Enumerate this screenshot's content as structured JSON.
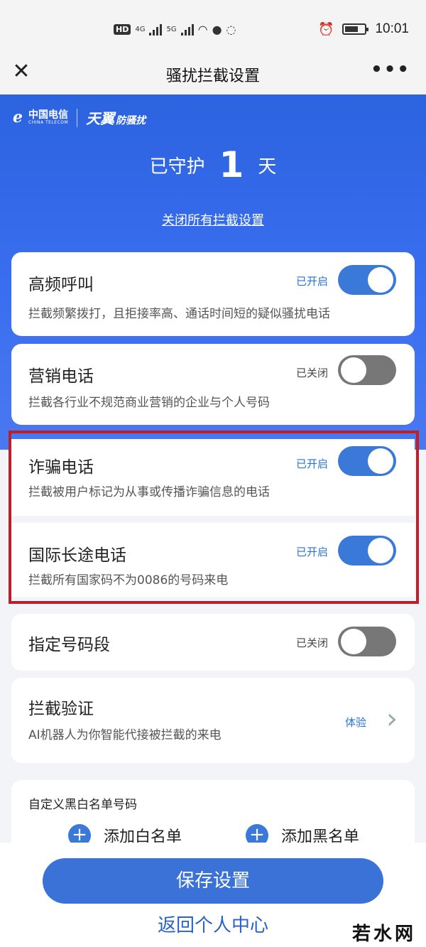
{
  "status": {
    "hd": "HD",
    "net1": "4G",
    "net2": "5G",
    "time": "10:01"
  },
  "nav": {
    "title": "骚扰拦截设置"
  },
  "hero": {
    "logo_cn": "中国电信",
    "logo_en": "CHINA TELECOM",
    "brand": "天翼",
    "brand_sub": "防骚扰",
    "guard_prefix": "已守护",
    "guard_days": "1",
    "guard_suffix": "天",
    "close_all": "关闭所有拦截设置"
  },
  "settings": [
    {
      "title": "高频呼叫",
      "desc": "拦截频繁拨打，且拒接率高、通话时间短的疑似骚扰电话",
      "state": "已开启",
      "on": true
    },
    {
      "title": "营销电话",
      "desc": "拦截各行业不规范商业营销的企业与个人号码",
      "state": "已关闭",
      "on": false
    },
    {
      "title": "诈骗电话",
      "desc": "拦截被用户标记为从事或传播诈骗信息的电话",
      "state": "已开启",
      "on": true
    },
    {
      "title": "国际长途电话",
      "desc": "拦截所有国家码不为0086的号码来电",
      "state": "已开启",
      "on": true
    },
    {
      "title": "指定号码段",
      "state": "已关闭",
      "on": false
    }
  ],
  "verify": {
    "title": "拦截验证",
    "desc": "AI机器人为你智能代接被拦截的来电",
    "trial": "体验"
  },
  "custom": {
    "title": "自定义黑白名单号码",
    "add_white": "添加白名单",
    "add_black": "添加黑名单"
  },
  "bottom": {
    "save": "保存设置",
    "back": "返回个人中心",
    "watermark": "若水网"
  },
  "colors": {
    "accent": "#3a79d8",
    "hero": "#2c63df",
    "highlight_border": "#b8202a"
  }
}
